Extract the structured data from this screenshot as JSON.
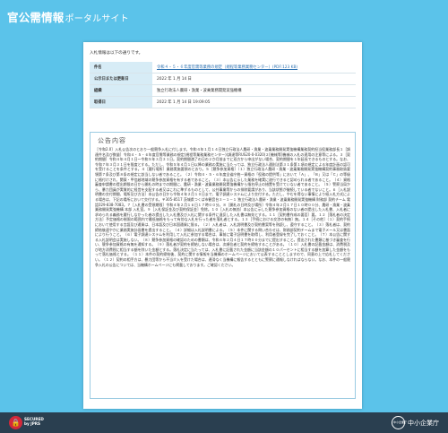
{
  "header": {
    "title": "官公需情報",
    "subtitle": "ポータルサイト"
  },
  "intro": "入札情報は以下の通りです。",
  "info": [
    {
      "label": "件名",
      "value": "令和４・５・６年度官需等業務の規定（規程等業務業務センター）(PDF:123 KB)",
      "is_link": true
    },
    {
      "label": "公示日または更新日",
      "value": "2022 年 1 月 14 日"
    },
    {
      "label": "組織",
      "value": "独立行政法人農研・漁業・波乗業務開発実強機構"
    },
    {
      "label": "取得日",
      "value": "2022 年 1 月 14 日 19:09:05"
    }
  ],
  "notice": {
    "title": "公告内容",
    "body": "［令和2.0］入札公告次のとおり一般競争入札に付します。令和４年１月１４日独立行政法人農研・漁業・波乗業務開発実強機構業務契約担当役業務部長１［調達件名及び数量］令和４・５・６年度官需等業務の規定(規程等業務業務センター)(調達等RUS20-0-0320)２[機械等]機械の入札の適用の注意等による。３［契約期間］令和４年４月１日～令和５年３月３１日。契約期間満了の日の２か月前までに双方から申出がない場合、契約期間を１年延長できるものとする。なお、令和７年３月３１日を限度とする。ただし、令和５年４月１日以降の業務の実施に当たっては、独立行政法人通則法第３１条第１項の規定による年度計画の認可を受けることを条件とする。４［履行場所］業務実施要領のとおり。５［競争参加資格］（１）独立行政法人農研・漁業・波乗業務開発実強機構契約事務取扱要領第７条及び第８条の規定に該当しない者であること。（２）令和４・５・６年度全省庁統一資格の「役務の提供等」において「Ａ」、「Ｂ」又は「Ｃ」の等級に格付けされ、関東・甲信越地域の競争参加資格を有する者であること。（３）本公告に示した業務を確実に遂行できると認められる者であること。（４）資格審査申請書の提出期限の日から開札の時までの期間に、農研・漁業・波乗業務開発実強機構から指名停止の措置を受けていない者であること。（５）警察当局から、暴力団員が実質的に経営を支配する者又はこれに準ずるものとして、公共事業等からの排除要請があり、当該状態が継続している者でないこと。６［入札説明書の交付期間、場所及び方法］本公告の日から令和４年２月１０日まで、電子調達システムにより交付する。ただし、やむを得ない事情により紙入札方式による場合は、下記の場所において交付する。〒305-8517 茨城県つくば市観音台３－１－１ 独立行政法人農研・漁業・波乗業務開発実強機構 財務部 契約チーム 電話029-838-7083。７［入札書の受領期限］令和４年２月１６日１７時００分。８［開札の日時及び場所］令和４年２月１７日１０時００分、農研・漁業・波乗業務開発実強機構 本部 入札室。９［入札保証金及び契約保証金］免除。１０［入札の無効］本公告に示した競争参加資格のない者の提出した入札書、入札者に求められる義務を履行しなかった者の提出した入札書及び入札に関する条件に違反した入札書は無効とする。１１［契約書作成の要否］要。１２［落札者の決定方法］予定価格の制限の範囲内で最低価格をもって有効な入札を行った者を落札者とする。１３［手続における交渉の有無］無。１４［その他］（１）契約手続において使用する言語及び通貨は、日本語及び日本国通貨に限る。（２）入札者は、入札説明書及び契約書案等を熟読し、遵守すること。（３）落札者は、契約締結後速やかに業務実施計画書を提出すること。（４）詳細は入札説明書による。（５）本件に関する問い合わせは、財務部契約チームまで電子メール又は書面により行うこと。（６）電子調達システムを利用して入札に参加する場合は、事前に電子証明書を取得し、利用者登録を完了しておくこと。（７）本公告に関する入札説明会は実施しない。（８）競争参加資格の確認のための書類は、令和４年２月４日１７時００分までに提出すること。提出された書類に基づき審査を行い、競争参加資格の有無を通知する。（９）落札者が契約を締結しない場合は、次順位者と契約を締結することがある。（１０）入札書の記載金額は、消費税及び地方消費税に相当する額を除いた金額とする。落札決定に当たっては、入札書に記載された金額に当該金額の１０パーセントに相当する額を加算した金額をもって落札価格とする。（１１）本件の契約締結後、契約に関する情報を当機構のホームページにおいて公表することとしますので、同意の上で応札してください。（１２）契約の相手方は、暴力団等から不当介入を受けた場合は、遅滞なく当機構に報告するとともに警察に通報しなければならない。なお、本件の一般競争入札の公告については、当機構ホームページにも掲載しております。ご確認ください。"
  },
  "footer": {
    "secured_line1": "SECURED",
    "secured_line2": "by JPRS",
    "brand_circle": "中小企業庁",
    "brand_name": "中小企業庁"
  },
  "colors": {
    "page_bg": "#5bc3ea",
    "table_label_bg": "#d7ecf6",
    "footer_bg": "#2a3f50",
    "link": "#2a6fb0"
  }
}
